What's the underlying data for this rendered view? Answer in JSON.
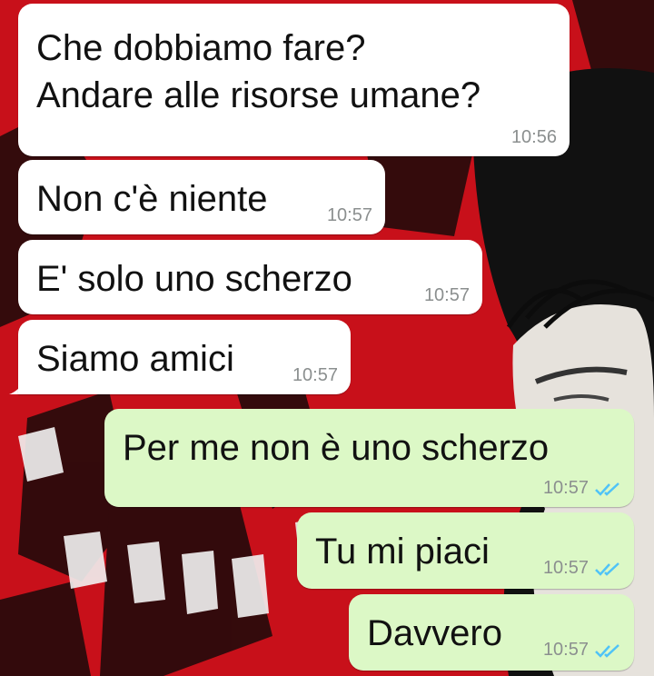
{
  "messages": [
    {
      "direction": "in",
      "text_lines": [
        "Che dobbiamo fare?",
        "Andare alle risorse umane?"
      ],
      "time": "10:56"
    },
    {
      "direction": "in",
      "text": "Non c'è niente",
      "time": "10:57"
    },
    {
      "direction": "in",
      "text": "E' solo uno scherzo",
      "time": "10:57"
    },
    {
      "direction": "in",
      "text": "Siamo amici",
      "time": "10:57"
    },
    {
      "direction": "out",
      "text": "Per me non è uno scherzo",
      "time": "10:57",
      "status": "read",
      "status_icon": "double-check-icon"
    },
    {
      "direction": "out",
      "text": "Tu mi piaci",
      "time": "10:57",
      "status": "read",
      "status_icon": "double-check-icon"
    },
    {
      "direction": "out",
      "text": "Davvero",
      "time": "10:57",
      "status": "read",
      "status_icon": "double-check-icon"
    }
  ],
  "colors": {
    "incoming_bubble": "#ffffff",
    "outgoing_bubble": "#dcf8c6",
    "read_ticks": "#4fc3f7",
    "timestamp": "#8b8f8f",
    "wallpaper": "#c8101a"
  }
}
